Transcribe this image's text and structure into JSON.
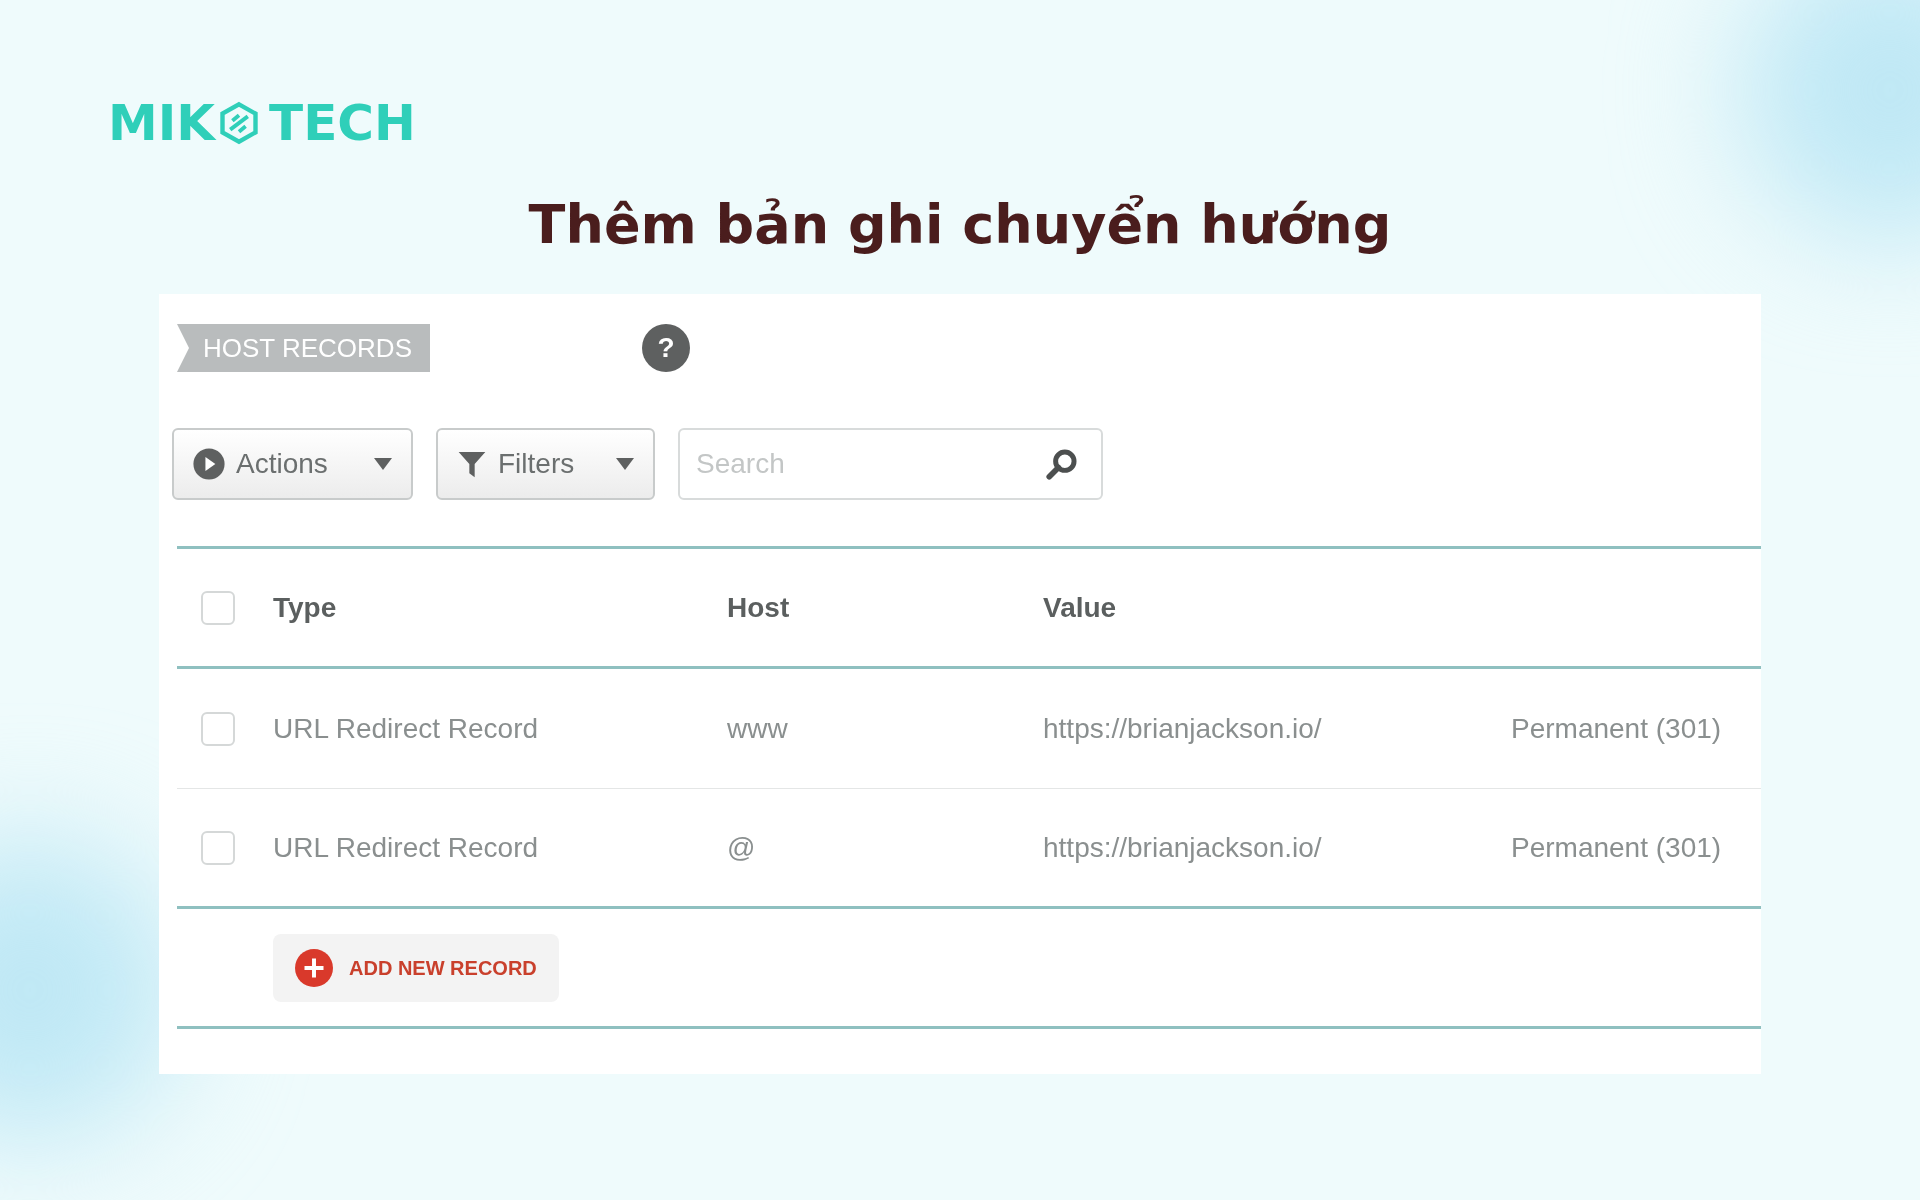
{
  "brand": {
    "left": "MIK",
    "right": "TECH"
  },
  "heading": "Thêm bản ghi chuyển hướng",
  "panel": {
    "tag": "HOST RECORDS",
    "help": "?",
    "toolbar": {
      "actions": "Actions",
      "filters": "Filters",
      "search": {
        "placeholder": "Search"
      }
    },
    "table": {
      "select_all": {
        "checked": false
      },
      "columns": [
        "Type",
        "Host",
        "Value"
      ],
      "rows": [
        {
          "checked": false,
          "cells": [
            "URL Redirect Record",
            "www",
            "https://brianjackson.io/",
            "Permanent (301)"
          ]
        },
        {
          "checked": false,
          "cells": [
            "URL Redirect Record",
            "@",
            "https://brianjackson.io/",
            "Permanent (301)"
          ]
        }
      ]
    },
    "add_button": "ADD NEW RECORD"
  }
}
